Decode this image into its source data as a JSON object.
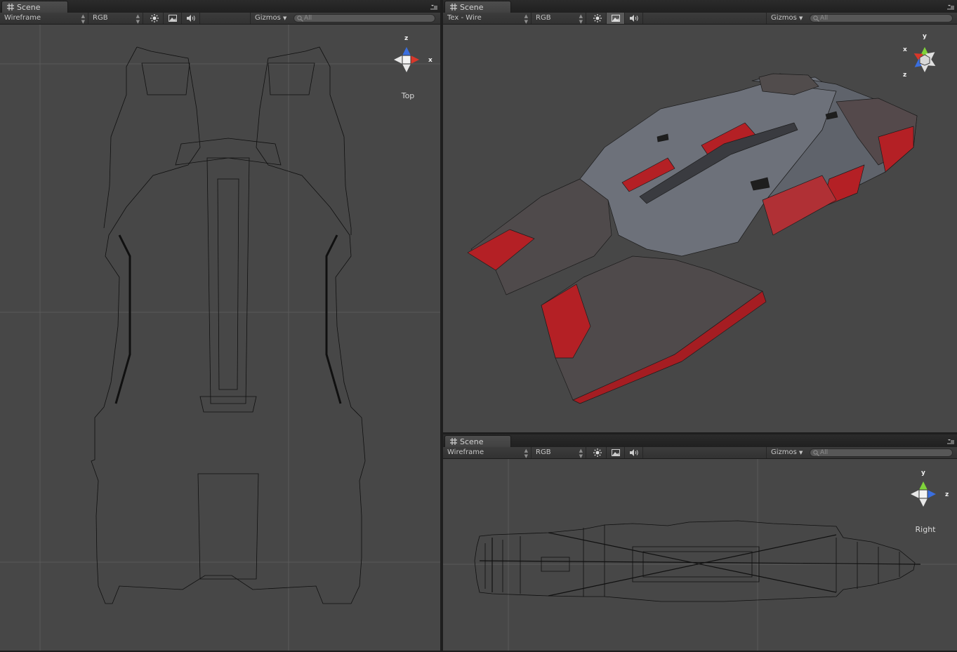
{
  "panels": {
    "top_view": {
      "tab_label": "Scene",
      "render_mode": "Wireframe",
      "channel": "RGB",
      "gizmos_label": "Gizmos",
      "search_placeholder": "All",
      "view_label": "Top",
      "axes": {
        "a": "z",
        "b": "x"
      }
    },
    "perspective": {
      "tab_label": "Scene",
      "render_mode": "Tex - Wire",
      "channel": "RGB",
      "gizmos_label": "Gizmos",
      "search_placeholder": "All",
      "axes": {
        "a": "y",
        "b": "x",
        "c": "z"
      }
    },
    "right_view": {
      "tab_label": "Scene",
      "render_mode": "Wireframe",
      "channel": "RGB",
      "gizmos_label": "Gizmos",
      "search_placeholder": "All",
      "view_label": "Right",
      "axes": {
        "a": "y",
        "b": "z"
      }
    }
  },
  "icons": {
    "tab": "scene-grid-icon",
    "lighting": "sun-icon",
    "fx": "image-icon",
    "audio": "speaker-icon",
    "menu": "panel-menu-icon",
    "search": "search-icon"
  },
  "colors": {
    "x_axis": "#d9372a",
    "y_axis": "#7fd33a",
    "z_axis": "#3a6fe0",
    "hull_red": "#b42025",
    "hull_gray": "#6d717a"
  }
}
